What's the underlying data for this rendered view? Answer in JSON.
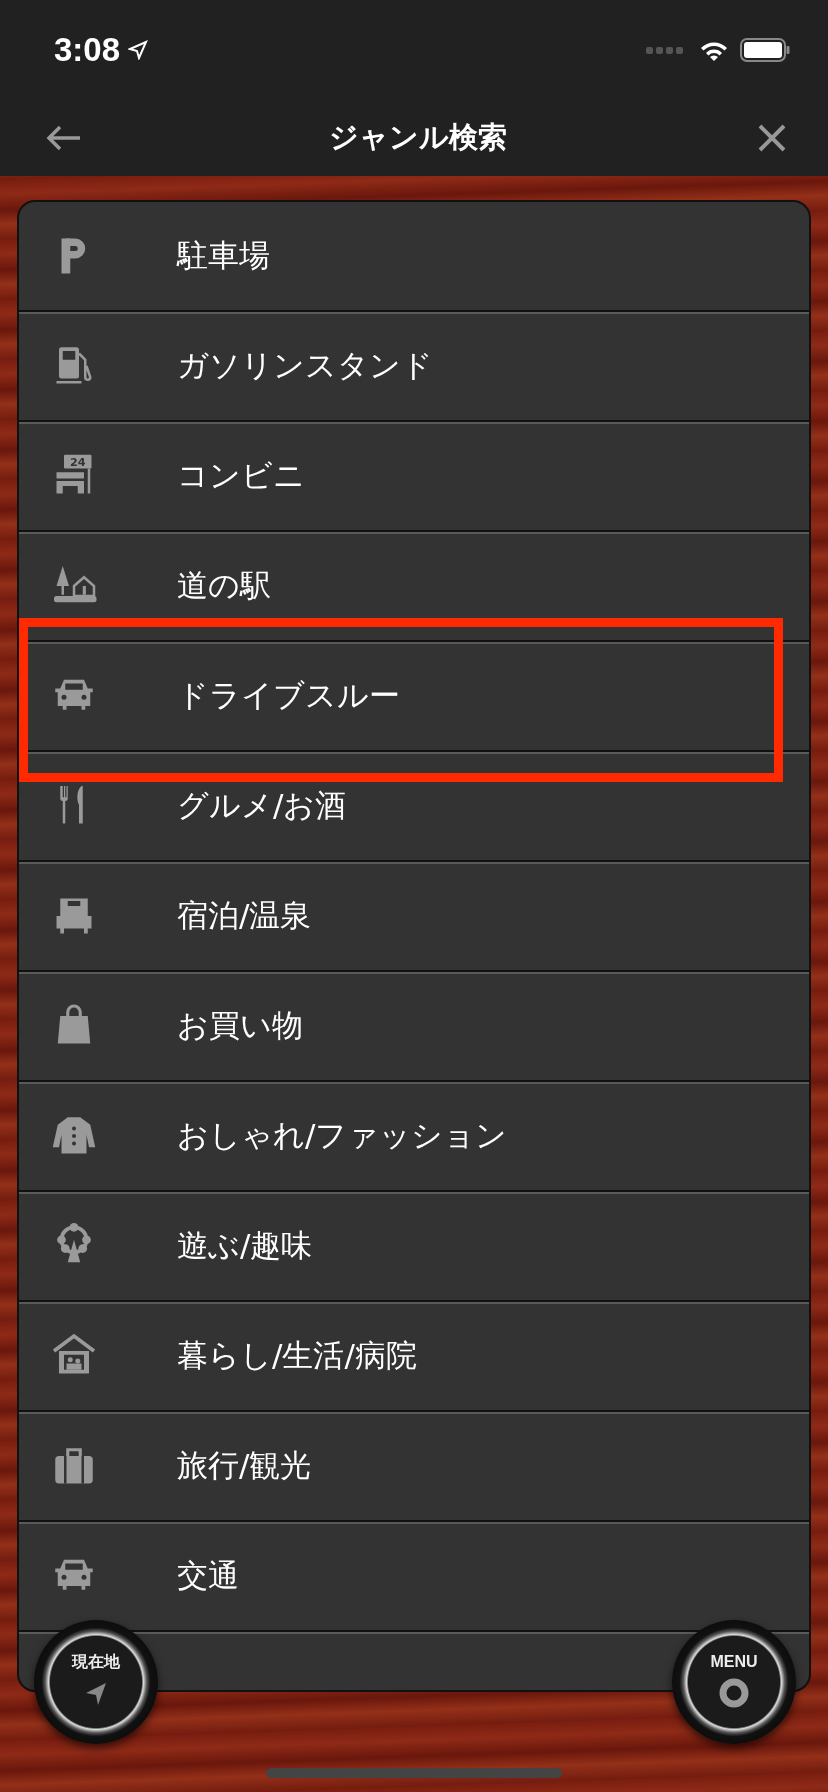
{
  "status_bar": {
    "time": "3:08"
  },
  "nav": {
    "title": "ジャンル検索"
  },
  "genres": [
    {
      "label": "駐車場",
      "highlighted": false
    },
    {
      "label": "ガソリンスタンド",
      "highlighted": false
    },
    {
      "label": "コンビニ",
      "highlighted": false,
      "icon_text": "24"
    },
    {
      "label": "道の駅",
      "highlighted": false
    },
    {
      "label": "ドライブスルー",
      "highlighted": true
    },
    {
      "label": "グルメ/お酒",
      "highlighted": false
    },
    {
      "label": "宿泊/温泉",
      "highlighted": false
    },
    {
      "label": "お買い物",
      "highlighted": false
    },
    {
      "label": "おしゃれ/ファッション",
      "highlighted": false
    },
    {
      "label": "遊ぶ/趣味",
      "highlighted": false
    },
    {
      "label": "暮らし/生活/病院",
      "highlighted": false
    },
    {
      "label": "旅行/観光",
      "highlighted": false
    },
    {
      "label": "交通",
      "highlighted": false
    }
  ],
  "floating_buttons": [
    {
      "label": "現在地",
      "kind": "location"
    },
    {
      "label": "MENU",
      "kind": "menu"
    }
  ]
}
